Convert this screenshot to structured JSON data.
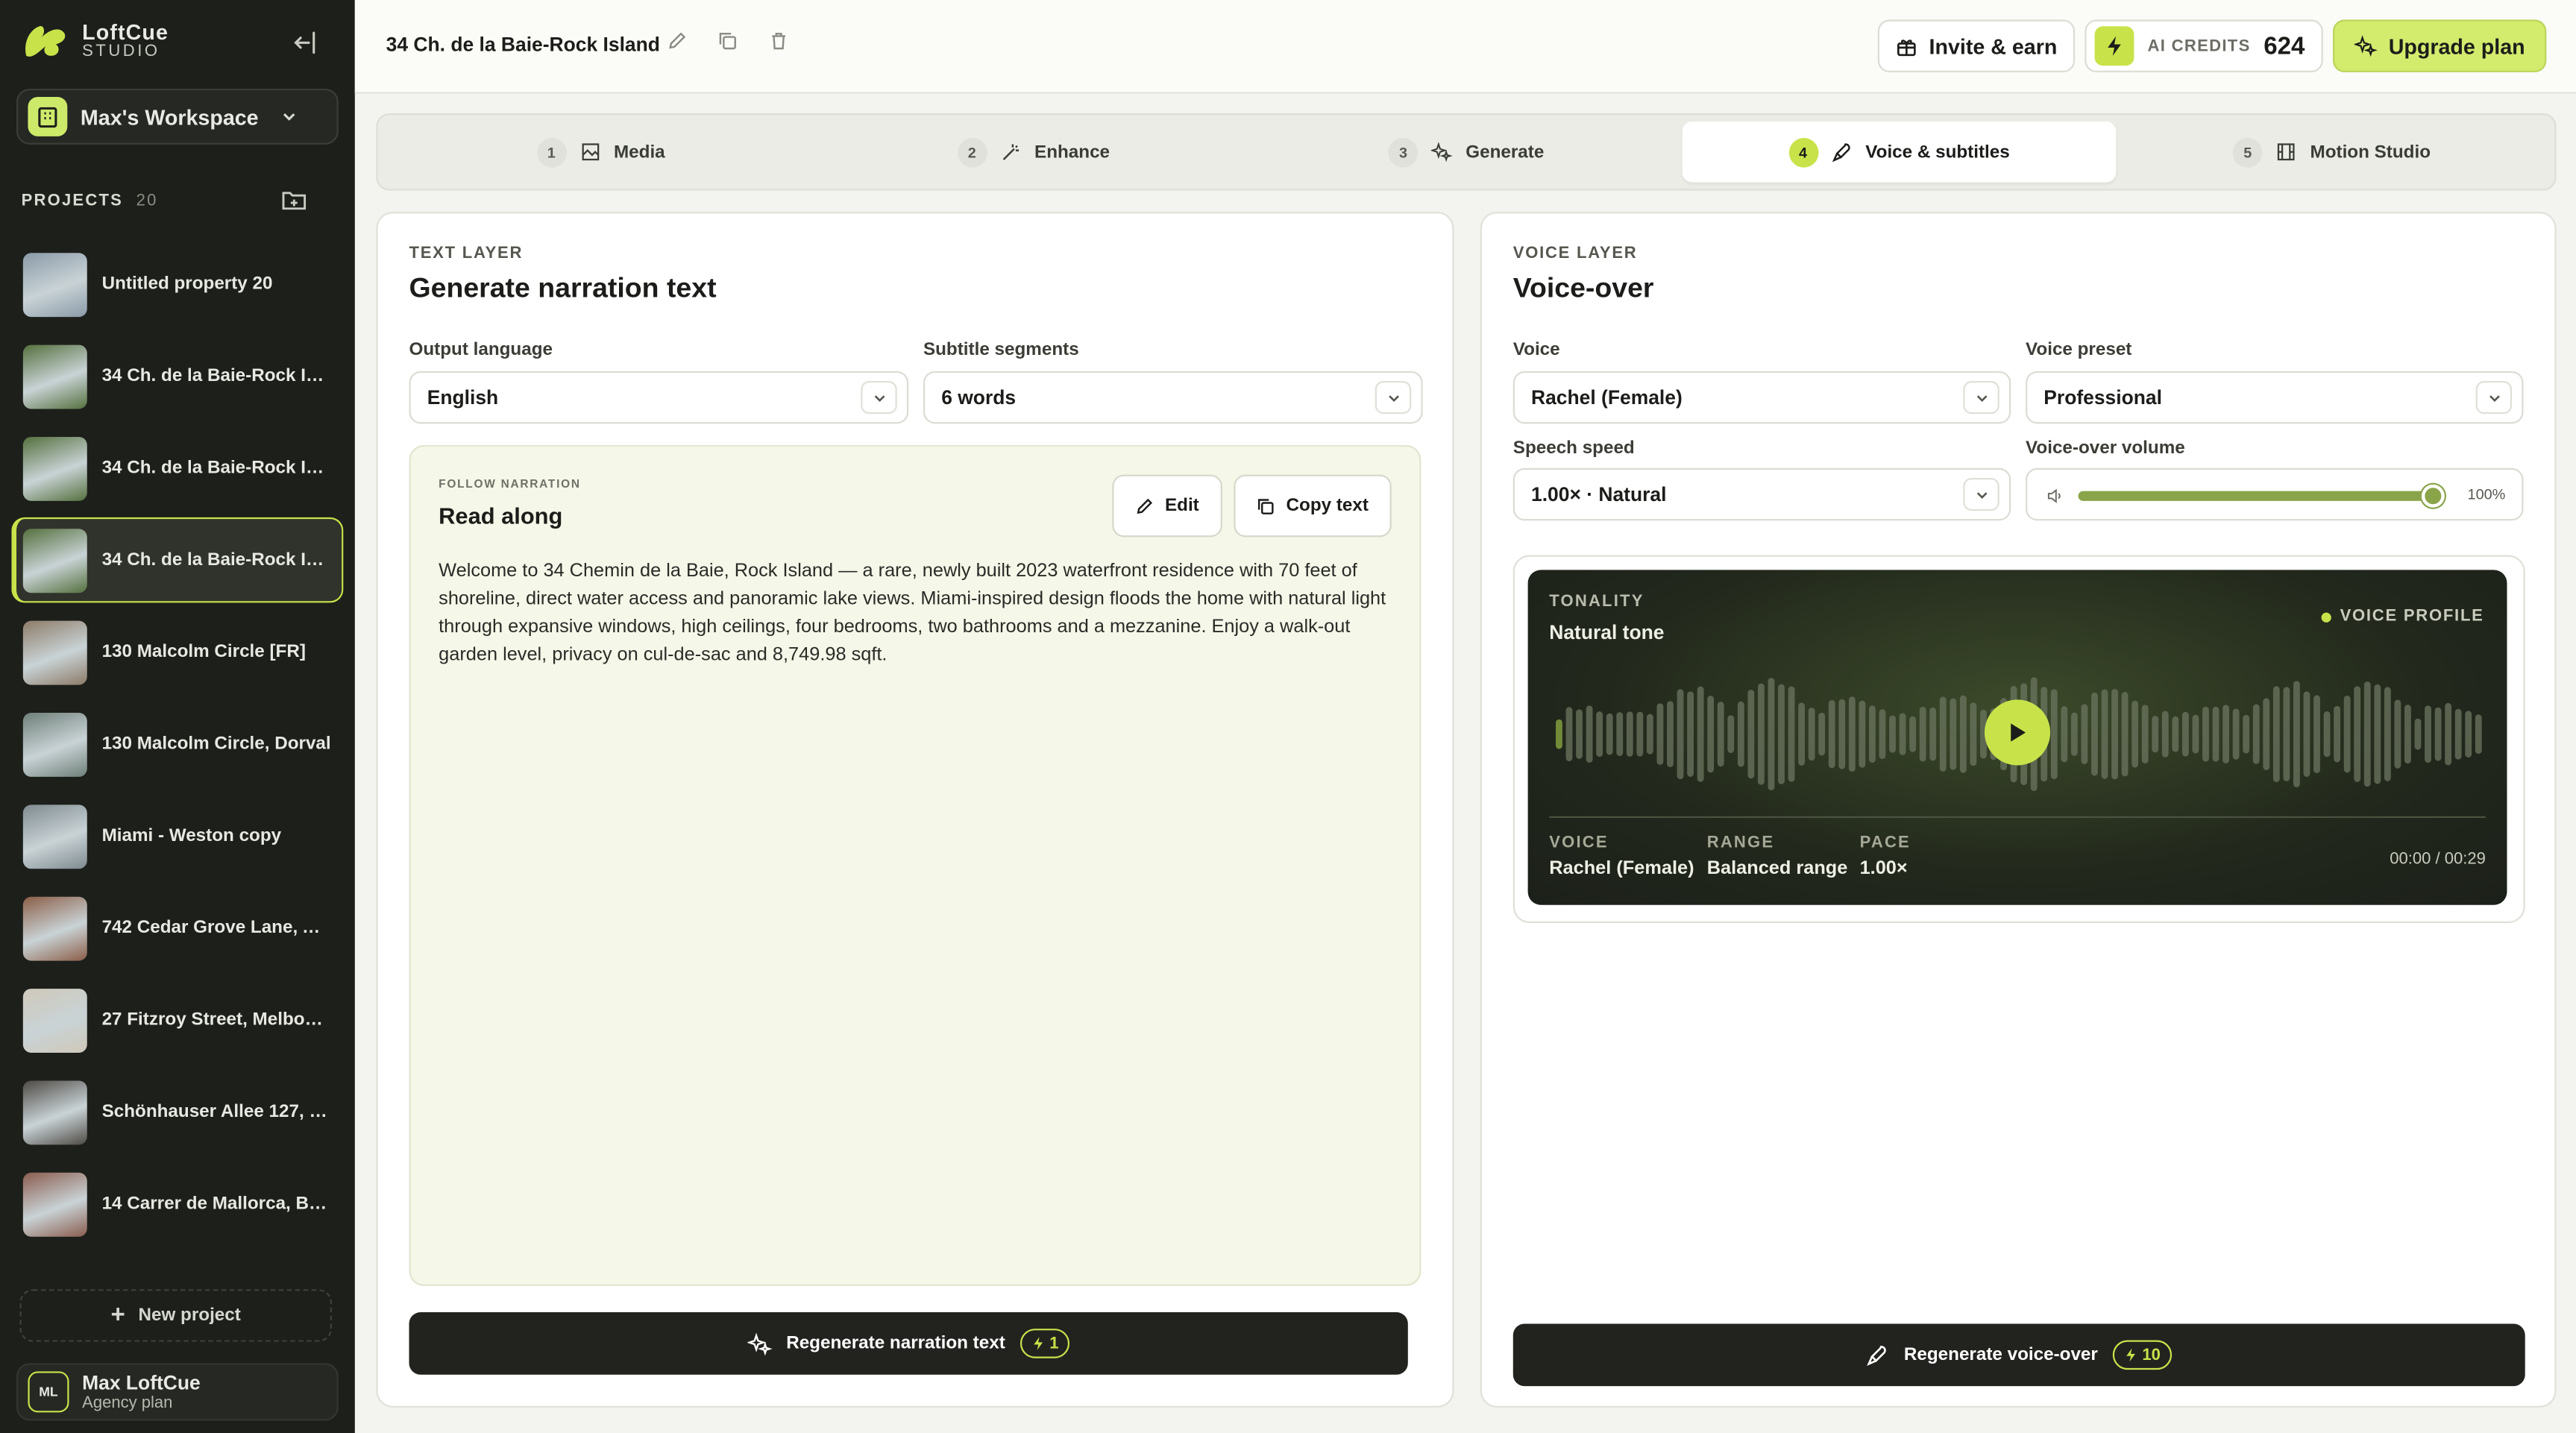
{
  "brand": {
    "name": "LoftCue",
    "sub": "STUDIO"
  },
  "workspace": {
    "name": "Max's Workspace"
  },
  "projects": {
    "label": "PROJECTS",
    "count": "20",
    "items": [
      {
        "name": "Untitled property 20",
        "active": false,
        "thumb": "#8a9aa8"
      },
      {
        "name": "34 Ch. de la Baie-Rock Isl...",
        "active": false,
        "thumb": "#55703e"
      },
      {
        "name": "34 Ch. de la Baie-Rock Isl...",
        "active": false,
        "thumb": "#55703e"
      },
      {
        "name": "34 Ch. de la Baie-Rock Isl...",
        "active": true,
        "thumb": "#55703e"
      },
      {
        "name": "130 Malcolm Circle [FR]",
        "active": false,
        "thumb": "#8c7b68"
      },
      {
        "name": "130 Malcolm Circle, Dorval",
        "active": false,
        "thumb": "#6e7f78"
      },
      {
        "name": "Miami - Weston copy",
        "active": false,
        "thumb": "#7f8a8f"
      },
      {
        "name": "742 Cedar Grove Lane, Au...",
        "active": false,
        "thumb": "#8b5e48"
      },
      {
        "name": "27 Fitzroy Street, Melbour...",
        "active": false,
        "thumb": "#cfc8ba"
      },
      {
        "name": "Schönhauser Allee 127, Be...",
        "active": false,
        "thumb": "#4e4a45"
      },
      {
        "name": "14 Carrer de Mallorca, Bar...",
        "active": false,
        "thumb": "#8a5d4f"
      }
    ],
    "new_label": "New project"
  },
  "user": {
    "initials": "ML",
    "name": "Max LoftCue",
    "plan": "Agency plan"
  },
  "topbar": {
    "title": "34 Ch. de la Baie-Rock Island",
    "invite": "Invite & earn",
    "credits_label": "AI CREDITS",
    "credits_value": "624",
    "upgrade": "Upgrade plan"
  },
  "steps": [
    {
      "num": "1",
      "label": "Media",
      "active": false
    },
    {
      "num": "2",
      "label": "Enhance",
      "active": false
    },
    {
      "num": "3",
      "label": "Generate",
      "active": false
    },
    {
      "num": "4",
      "label": "Voice & subtitles",
      "active": true
    },
    {
      "num": "5",
      "label": "Motion Studio",
      "active": false
    }
  ],
  "text_layer": {
    "eyebrow": "TEXT LAYER",
    "title": "Generate narration text",
    "output_language_label": "Output language",
    "output_language": "English",
    "subtitle_label": "Subtitle segments",
    "subtitle_value": "6 words",
    "read": {
      "eyebrow": "FOLLOW NARRATION",
      "title": "Read along",
      "edit": "Edit",
      "copy": "Copy text",
      "text": "Welcome to 34 Chemin de la Baie, Rock Island — a rare, newly built 2023 waterfront residence with 70 feet of shoreline, direct water access and panoramic lake views. Miami-inspired design floods the home with natural light through expansive windows, high ceilings, four bedrooms, two bathrooms and a mezzanine. Enjoy a walk-out garden level, privacy on cul-de-sac and 8,749.98 sqft."
    },
    "regen_label": "Regenerate narration text",
    "regen_cost": "1"
  },
  "voice_layer": {
    "eyebrow": "VOICE LAYER",
    "title": "Voice-over",
    "voice_label": "Voice",
    "voice": "Rachel (Female)",
    "preset_label": "Voice preset",
    "preset": "Professional",
    "speed_label": "Speech speed",
    "speed": "1.00× · Natural",
    "volume_label": "Voice-over volume",
    "volume_pct": "100%",
    "volume_fraction": 1.0,
    "profile": {
      "eyebrow": "TONALITY",
      "title": "Natural tone",
      "badge": "VOICE PROFILE",
      "voice_k": "VOICE",
      "voice_v": "Rachel (Female)",
      "range_k": "RANGE",
      "range_v": "Balanced range",
      "pace_k": "PACE",
      "pace_v": "1.00×",
      "time": "00:00 / 00:29"
    },
    "regen_label": "Regenerate voice-over",
    "regen_cost": "10"
  }
}
